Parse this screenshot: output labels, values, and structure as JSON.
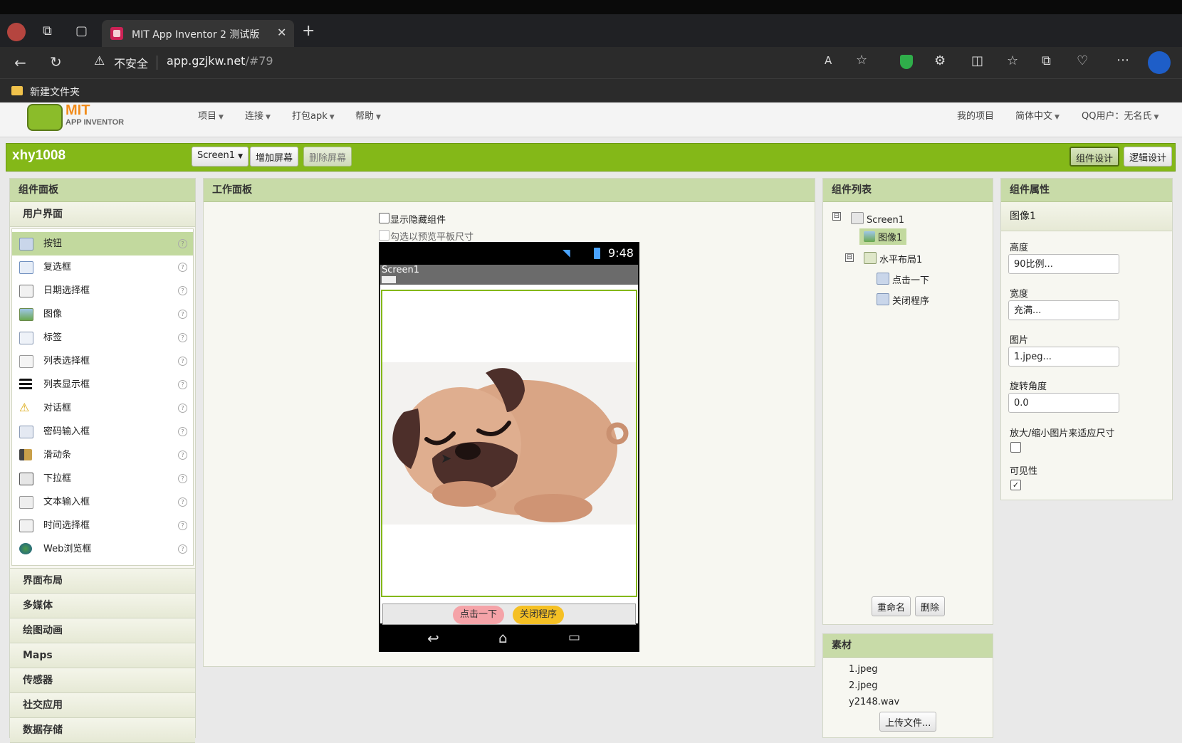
{
  "browser": {
    "tab_title": "MIT App Inventor 2 测试版",
    "security_label": "不安全",
    "url_host": "app.gzjkw.net",
    "url_path": "/#79",
    "bookmark_folder": "新建文件夹"
  },
  "header": {
    "logo_top": "MIT",
    "logo_bottom": "APP INVENTOR",
    "menus": [
      "项目",
      "连接",
      "打包apk",
      "帮助"
    ],
    "right_links": [
      "我的项目",
      "简体中文",
      "QQ用户：无名氏"
    ]
  },
  "project": {
    "name": "xhy1008",
    "screen_select": "Screen1",
    "add_screen": "增加屏幕",
    "remove_screen": "删除屏幕",
    "designer": "组件设计",
    "blocks": "逻辑设计"
  },
  "palette": {
    "title": "组件面板",
    "section_ui": "用户界面",
    "items": [
      "按钮",
      "复选框",
      "日期选择框",
      "图像",
      "标签",
      "列表选择框",
      "列表显示框",
      "对话框",
      "密码输入框",
      "滑动条",
      "下拉框",
      "文本输入框",
      "时间选择框",
      "Web浏览框"
    ],
    "help": "?",
    "sections": [
      "界面布局",
      "多媒体",
      "绘图动画",
      "Maps",
      "传感器",
      "社交应用",
      "数据存储"
    ]
  },
  "viewer": {
    "title": "工作面板",
    "show_hidden": "显示隐藏组件",
    "tablet_preview": "勾选以预览平板尺寸",
    "status_time": "9:48",
    "screen_title": "Screen1",
    "btn_click": "点击一下",
    "btn_close": "关闭程序"
  },
  "components": {
    "title": "组件列表",
    "tree": {
      "screen": "Screen1",
      "image": "图像1",
      "layout": "水平布局1",
      "button1": "点击一下",
      "button2": "关闭程序"
    },
    "rename": "重命名",
    "delete": "删除",
    "toggle_symbol": "⊟"
  },
  "media": {
    "title": "素材",
    "files": [
      "1.jpeg",
      "2.jpeg",
      "y2148.wav"
    ],
    "upload": "上传文件..."
  },
  "properties": {
    "title": "组件属性",
    "component": "图像1",
    "height_label": "高度",
    "height_value": "90比例...",
    "width_label": "宽度",
    "width_value": "充满...",
    "picture_label": "图片",
    "picture_value": "1.jpeg...",
    "rotation_label": "旋转角度",
    "rotation_value": "0.0",
    "scale_label": "放大/缩小图片来适应尺寸",
    "visible_label": "可见性",
    "check_mark": "✓"
  },
  "colors": {
    "green_bar": "#84b818",
    "panel_head": "#c8dba8",
    "selected": "#c2d99e"
  }
}
